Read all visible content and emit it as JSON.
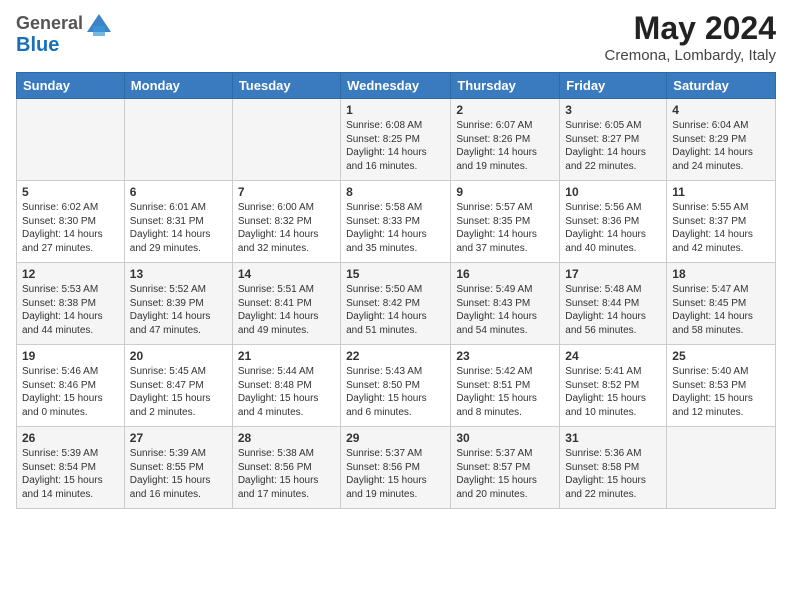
{
  "logo": {
    "general": "General",
    "blue": "Blue"
  },
  "title": "May 2024",
  "location": "Cremona, Lombardy, Italy",
  "days_header": [
    "Sunday",
    "Monday",
    "Tuesday",
    "Wednesday",
    "Thursday",
    "Friday",
    "Saturday"
  ],
  "weeks": [
    [
      {
        "day": "",
        "info": ""
      },
      {
        "day": "",
        "info": ""
      },
      {
        "day": "",
        "info": ""
      },
      {
        "day": "1",
        "info": "Sunrise: 6:08 AM\nSunset: 8:25 PM\nDaylight: 14 hours and 16 minutes."
      },
      {
        "day": "2",
        "info": "Sunrise: 6:07 AM\nSunset: 8:26 PM\nDaylight: 14 hours and 19 minutes."
      },
      {
        "day": "3",
        "info": "Sunrise: 6:05 AM\nSunset: 8:27 PM\nDaylight: 14 hours and 22 minutes."
      },
      {
        "day": "4",
        "info": "Sunrise: 6:04 AM\nSunset: 8:29 PM\nDaylight: 14 hours and 24 minutes."
      }
    ],
    [
      {
        "day": "5",
        "info": "Sunrise: 6:02 AM\nSunset: 8:30 PM\nDaylight: 14 hours and 27 minutes."
      },
      {
        "day": "6",
        "info": "Sunrise: 6:01 AM\nSunset: 8:31 PM\nDaylight: 14 hours and 29 minutes."
      },
      {
        "day": "7",
        "info": "Sunrise: 6:00 AM\nSunset: 8:32 PM\nDaylight: 14 hours and 32 minutes."
      },
      {
        "day": "8",
        "info": "Sunrise: 5:58 AM\nSunset: 8:33 PM\nDaylight: 14 hours and 35 minutes."
      },
      {
        "day": "9",
        "info": "Sunrise: 5:57 AM\nSunset: 8:35 PM\nDaylight: 14 hours and 37 minutes."
      },
      {
        "day": "10",
        "info": "Sunrise: 5:56 AM\nSunset: 8:36 PM\nDaylight: 14 hours and 40 minutes."
      },
      {
        "day": "11",
        "info": "Sunrise: 5:55 AM\nSunset: 8:37 PM\nDaylight: 14 hours and 42 minutes."
      }
    ],
    [
      {
        "day": "12",
        "info": "Sunrise: 5:53 AM\nSunset: 8:38 PM\nDaylight: 14 hours and 44 minutes."
      },
      {
        "day": "13",
        "info": "Sunrise: 5:52 AM\nSunset: 8:39 PM\nDaylight: 14 hours and 47 minutes."
      },
      {
        "day": "14",
        "info": "Sunrise: 5:51 AM\nSunset: 8:41 PM\nDaylight: 14 hours and 49 minutes."
      },
      {
        "day": "15",
        "info": "Sunrise: 5:50 AM\nSunset: 8:42 PM\nDaylight: 14 hours and 51 minutes."
      },
      {
        "day": "16",
        "info": "Sunrise: 5:49 AM\nSunset: 8:43 PM\nDaylight: 14 hours and 54 minutes."
      },
      {
        "day": "17",
        "info": "Sunrise: 5:48 AM\nSunset: 8:44 PM\nDaylight: 14 hours and 56 minutes."
      },
      {
        "day": "18",
        "info": "Sunrise: 5:47 AM\nSunset: 8:45 PM\nDaylight: 14 hours and 58 minutes."
      }
    ],
    [
      {
        "day": "19",
        "info": "Sunrise: 5:46 AM\nSunset: 8:46 PM\nDaylight: 15 hours and 0 minutes."
      },
      {
        "day": "20",
        "info": "Sunrise: 5:45 AM\nSunset: 8:47 PM\nDaylight: 15 hours and 2 minutes."
      },
      {
        "day": "21",
        "info": "Sunrise: 5:44 AM\nSunset: 8:48 PM\nDaylight: 15 hours and 4 minutes."
      },
      {
        "day": "22",
        "info": "Sunrise: 5:43 AM\nSunset: 8:50 PM\nDaylight: 15 hours and 6 minutes."
      },
      {
        "day": "23",
        "info": "Sunrise: 5:42 AM\nSunset: 8:51 PM\nDaylight: 15 hours and 8 minutes."
      },
      {
        "day": "24",
        "info": "Sunrise: 5:41 AM\nSunset: 8:52 PM\nDaylight: 15 hours and 10 minutes."
      },
      {
        "day": "25",
        "info": "Sunrise: 5:40 AM\nSunset: 8:53 PM\nDaylight: 15 hours and 12 minutes."
      }
    ],
    [
      {
        "day": "26",
        "info": "Sunrise: 5:39 AM\nSunset: 8:54 PM\nDaylight: 15 hours and 14 minutes."
      },
      {
        "day": "27",
        "info": "Sunrise: 5:39 AM\nSunset: 8:55 PM\nDaylight: 15 hours and 16 minutes."
      },
      {
        "day": "28",
        "info": "Sunrise: 5:38 AM\nSunset: 8:56 PM\nDaylight: 15 hours and 17 minutes."
      },
      {
        "day": "29",
        "info": "Sunrise: 5:37 AM\nSunset: 8:56 PM\nDaylight: 15 hours and 19 minutes."
      },
      {
        "day": "30",
        "info": "Sunrise: 5:37 AM\nSunset: 8:57 PM\nDaylight: 15 hours and 20 minutes."
      },
      {
        "day": "31",
        "info": "Sunrise: 5:36 AM\nSunset: 8:58 PM\nDaylight: 15 hours and 22 minutes."
      },
      {
        "day": "",
        "info": ""
      }
    ]
  ]
}
